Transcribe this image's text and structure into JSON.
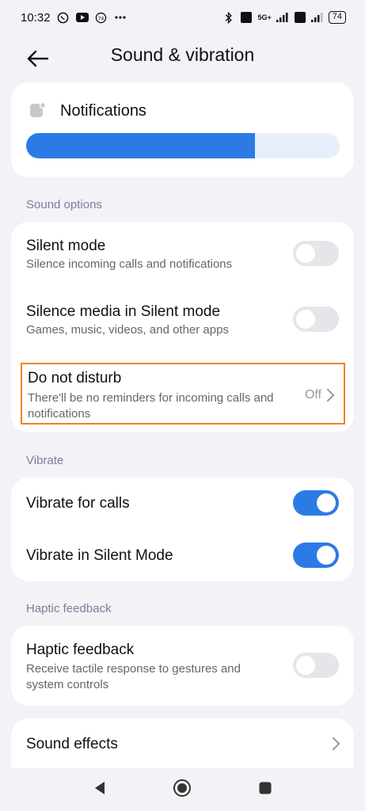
{
  "status": {
    "time": "10:32",
    "left_icons": [
      "whatsapp-icon",
      "youtube-icon",
      "notification-74-icon",
      "more-dots-icon"
    ],
    "right_icons": [
      "bluetooth-icon",
      "volte-icon",
      "signal-5g-icon",
      "signal-icon",
      "volte-lte-icon",
      "signal-icon"
    ],
    "network_label": "5G+",
    "battery": "74"
  },
  "header": {
    "title": "Sound & vibration",
    "back_icon": "arrow-left-icon"
  },
  "notifications": {
    "label": "Notifications",
    "icon": "notification-bell-icon",
    "volume_fraction": 0.73,
    "accent": "#2c7be5",
    "track": "#e7effc"
  },
  "sections": {
    "sound_options": "Sound options",
    "vibrate": "Vibrate",
    "haptic": "Haptic feedback"
  },
  "rows": {
    "silent_mode": {
      "title": "Silent mode",
      "subtitle": "Silence incoming calls and notifications",
      "on": false
    },
    "silence_media": {
      "title": "Silence media in Silent mode",
      "subtitle": "Games, music, videos, and other apps",
      "on": false
    },
    "dnd": {
      "title": "Do not disturb",
      "subtitle": "There'll be no reminders for incoming calls and notifications",
      "value": "Off",
      "highlight": "#f0831f"
    },
    "vibrate_calls": {
      "title": "Vibrate for calls",
      "on": true
    },
    "vibrate_silent": {
      "title": "Vibrate in Silent Mode",
      "on": true
    },
    "haptic": {
      "title": "Haptic feedback",
      "subtitle": "Receive tactile response to gestures and system controls",
      "on": false
    },
    "sound_effects": {
      "title": "Sound effects"
    }
  },
  "nav": [
    "back-triangle-icon",
    "home-circle-icon",
    "recents-square-icon"
  ]
}
